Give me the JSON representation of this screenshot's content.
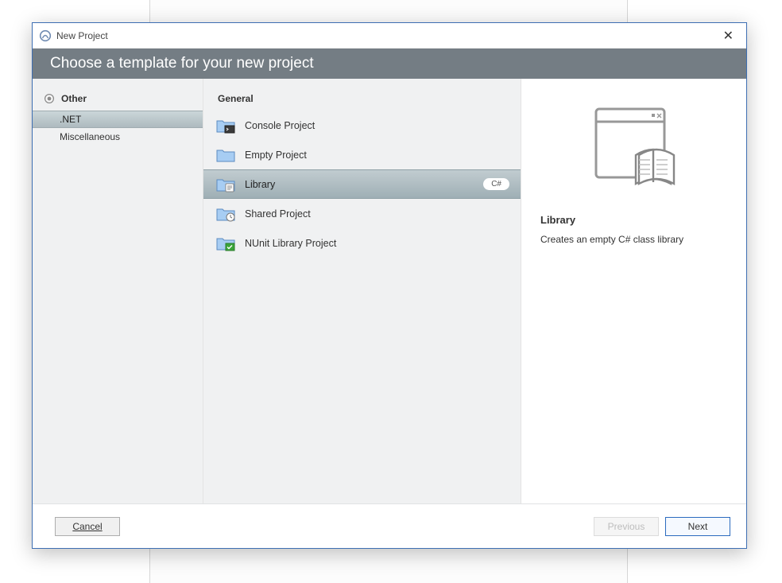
{
  "window": {
    "title": "New Project"
  },
  "banner": {
    "heading": "Choose a template for your new project"
  },
  "sidebar": {
    "category": "Other",
    "items": [
      {
        "label": ".NET",
        "selected": true
      },
      {
        "label": "Miscellaneous",
        "selected": false
      }
    ]
  },
  "templates": {
    "group": "General",
    "items": [
      {
        "label": "Console Project",
        "selected": false,
        "overlay": "console"
      },
      {
        "label": "Empty Project",
        "selected": false,
        "overlay": "none"
      },
      {
        "label": "Library",
        "selected": true,
        "badge": "C#",
        "overlay": "doc"
      },
      {
        "label": "Shared Project",
        "selected": false,
        "overlay": "clock"
      },
      {
        "label": "NUnit Library Project",
        "selected": false,
        "overlay": "nunit"
      }
    ]
  },
  "details": {
    "title": "Library",
    "description": "Creates an empty C# class library"
  },
  "footer": {
    "cancel": "Cancel",
    "previous": "Previous",
    "next": "Next"
  }
}
